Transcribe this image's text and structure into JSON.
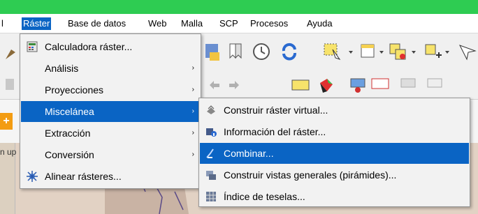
{
  "menubar": {
    "items": [
      {
        "label": "l"
      },
      {
        "label": "Ráster"
      },
      {
        "label": "Base de datos"
      },
      {
        "label": "Web"
      },
      {
        "label": "Malla"
      },
      {
        "label": "SCP"
      },
      {
        "label": "Procesos"
      },
      {
        "label": "Ayuda"
      }
    ]
  },
  "raster_menu": {
    "items": [
      {
        "label": "Calculadora ráster...",
        "icon": "calculator-icon"
      },
      {
        "label": "Análisis",
        "arrow": "›"
      },
      {
        "label": "Proyecciones",
        "arrow": "›"
      },
      {
        "label": "Miscelánea",
        "arrow": "›"
      },
      {
        "label": "Extracción",
        "arrow": "›"
      },
      {
        "label": "Conversión",
        "arrow": "›"
      },
      {
        "label": "Alinear rásteres...",
        "icon": "align-rasters-icon"
      }
    ]
  },
  "misc_submenu": {
    "items": [
      {
        "label": "Construir ráster virtual...",
        "icon": "virtual-raster-icon"
      },
      {
        "label": "Información del ráster...",
        "icon": "raster-info-icon"
      },
      {
        "label": "Combinar...",
        "icon": "merge-icon"
      },
      {
        "label": "Construir vistas generales (pirámides)...",
        "icon": "pyramids-icon"
      },
      {
        "label": "Índice de teselas...",
        "icon": "tile-index-icon"
      }
    ]
  },
  "side_panel": {
    "plus_label": "+",
    "text_fragment": "n up"
  },
  "colors": {
    "highlight": "#0a64c4",
    "title_bar": "#2ecc52",
    "menu_bg": "#f2f2f2",
    "canvas": "#e2d2c4"
  }
}
